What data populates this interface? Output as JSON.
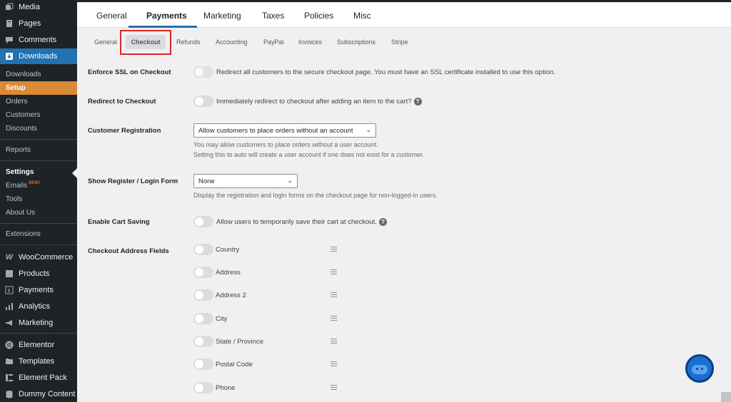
{
  "sidebar": {
    "top_items": [
      {
        "label": "Media",
        "icon": "media-icon"
      },
      {
        "label": "Pages",
        "icon": "pages-icon"
      },
      {
        "label": "Comments",
        "icon": "comments-icon"
      },
      {
        "label": "Downloads",
        "icon": "downloads-icon"
      }
    ],
    "sub_items": [
      "Downloads",
      "Setup",
      "Orders",
      "Customers",
      "Discounts",
      "Reports",
      "Settings",
      "Emails",
      "Tools",
      "About Us",
      "Extensions"
    ],
    "emails_badge": "NEW!",
    "bottom_items": [
      {
        "label": "WooCommerce",
        "icon": "woocommerce-icon"
      },
      {
        "label": "Products",
        "icon": "products-icon"
      },
      {
        "label": "Payments",
        "icon": "payments-icon"
      },
      {
        "label": "Analytics",
        "icon": "analytics-icon"
      },
      {
        "label": "Marketing",
        "icon": "marketing-icon"
      },
      {
        "label": "Elementor",
        "icon": "elementor-icon"
      },
      {
        "label": "Templates",
        "icon": "templates-icon"
      },
      {
        "label": "Element Pack",
        "icon": "element-pack-icon"
      },
      {
        "label": "Dummy Content",
        "icon": "dummy-content-icon"
      }
    ]
  },
  "top_tabs": [
    "General",
    "Payments",
    "Marketing",
    "Taxes",
    "Policies",
    "Misc"
  ],
  "sub_tabs": [
    "General",
    "Checkout",
    "Refunds",
    "Accounting",
    "PayPal",
    "Invoices",
    "Subscriptions",
    "Stripe"
  ],
  "settings": {
    "ssl": {
      "label": "Enforce SSL on Checkout",
      "desc": "Redirect all customers to the secure checkout page. You must have an SSL certificate installed to use this option."
    },
    "redirect": {
      "label": "Redirect to Checkout",
      "desc": "Immediately redirect to checkout after adding an item to the cart?"
    },
    "registration": {
      "label": "Customer Registration",
      "value": "Allow customers to place orders without an account",
      "note1": "You may allow customers to place orders without a user account.",
      "note2": "Setting this to auto will create a user account if one does not exist for a customer."
    },
    "login_form": {
      "label": "Show Register / Login Form",
      "value": "None",
      "note": "Display the registration and login forms on the checkout page for non-logged-in users."
    },
    "cart_saving": {
      "label": "Enable Cart Saving",
      "desc": "Allow users to temporarily save their cart at checkout."
    },
    "address": {
      "label": "Checkout Address Fields",
      "fields": [
        "Country",
        "Address",
        "Address 2",
        "City",
        "State / Province",
        "Postal Code",
        "Phone"
      ]
    }
  },
  "colors": {
    "accent": "#2271b1",
    "setup": "#d98a37",
    "highlight": "#e02424",
    "sidebar": "#1d2327"
  }
}
